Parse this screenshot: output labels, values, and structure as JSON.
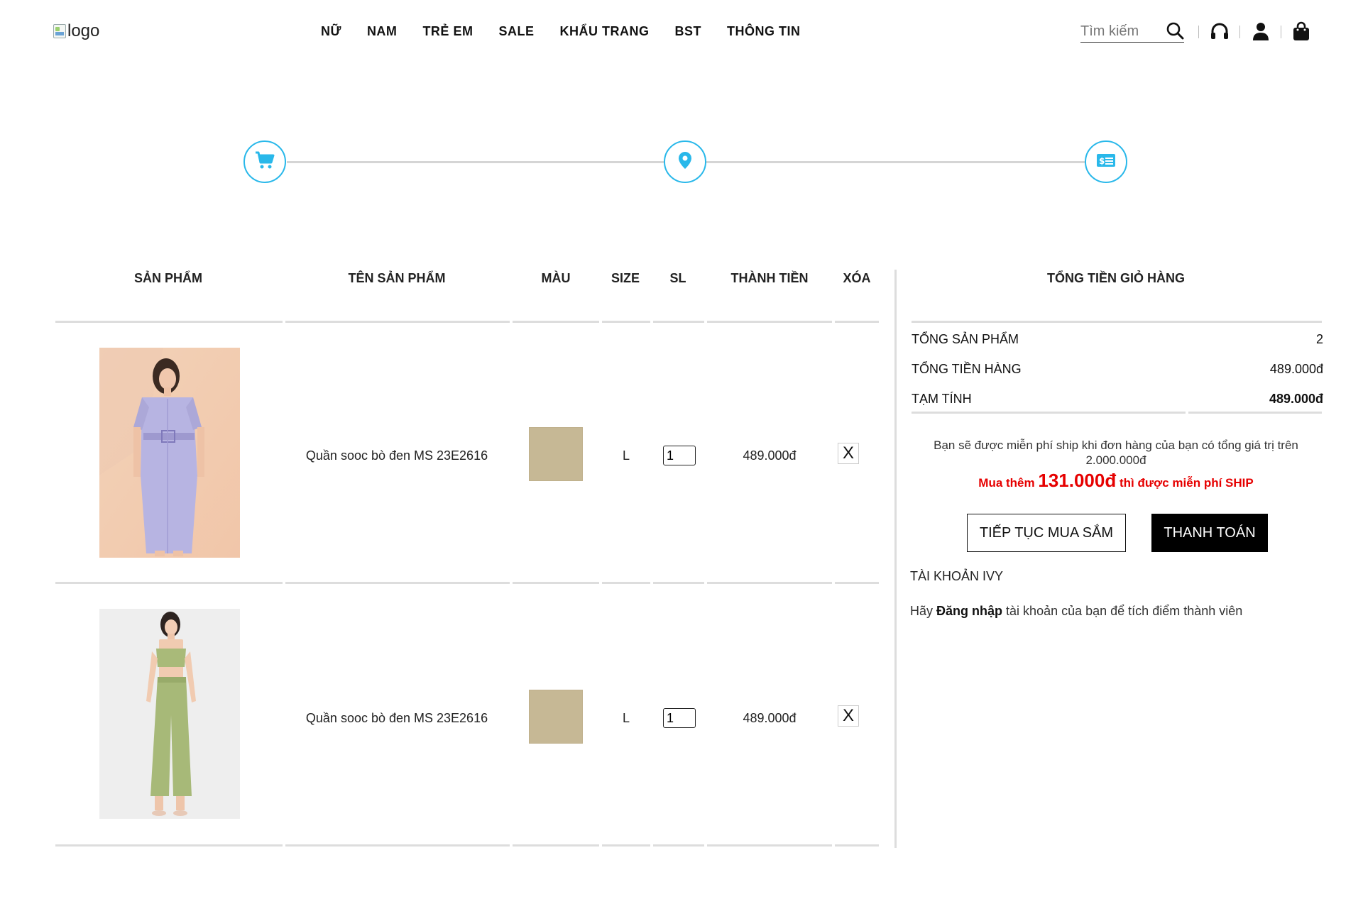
{
  "header": {
    "logo_alt": "logo",
    "nav": [
      "NỮ",
      "NAM",
      "TRẺ EM",
      "SALE",
      "KHẨU TRANG",
      "BST",
      "THÔNG TIN"
    ],
    "search_placeholder": "Tìm kiếm"
  },
  "steps": [
    {
      "icon": "cart-icon"
    },
    {
      "icon": "location-pin-icon"
    },
    {
      "icon": "payment-card-icon"
    }
  ],
  "accent_color": "#29b8ea",
  "table": {
    "headers": [
      "SẢN PHẨM",
      "TÊN SẢN PHẨM",
      "MÀU",
      "SIZE",
      "SL",
      "THÀNH TIỀN",
      "XÓA"
    ],
    "rows": [
      {
        "name": "Quần sooc bò đen MS 23E2616",
        "color_hex": "#c6b895",
        "size": "L",
        "qty": "1",
        "total": "489.000đ",
        "remove": "X"
      },
      {
        "name": "Quần sooc bò đen MS 23E2616",
        "color_hex": "#c6b895",
        "size": "L",
        "qty": "1",
        "total": "489.000đ",
        "remove": "X"
      }
    ]
  },
  "summary": {
    "title": "TỔNG TIỀN GIỎ HÀNG",
    "rows": [
      {
        "label": "TỔNG SẢN PHẨM",
        "value": "2"
      },
      {
        "label": "TỔNG TIỀN HÀNG",
        "value": "489.000đ"
      },
      {
        "label": "TẠM TÍNH",
        "value": "489.000đ"
      }
    ],
    "ship_note": "Bạn sẽ được miễn phí ship khi đơn hàng của bạn có tổng giá trị trên 2.000.000đ",
    "promo_prefix": "Mua thêm",
    "promo_amount": "131.000đ",
    "promo_suffix": "thì được miễn phí SHIP",
    "continue_label": "TIẾP TỤC MUA SẮM",
    "pay_label": "THANH TOÁN",
    "account_title": "TÀI KHOẢN IVY",
    "account_prefix": "Hãy",
    "account_link": "Đăng nhập",
    "account_suffix": "tài khoản của bạn để tích điểm thành viên"
  }
}
